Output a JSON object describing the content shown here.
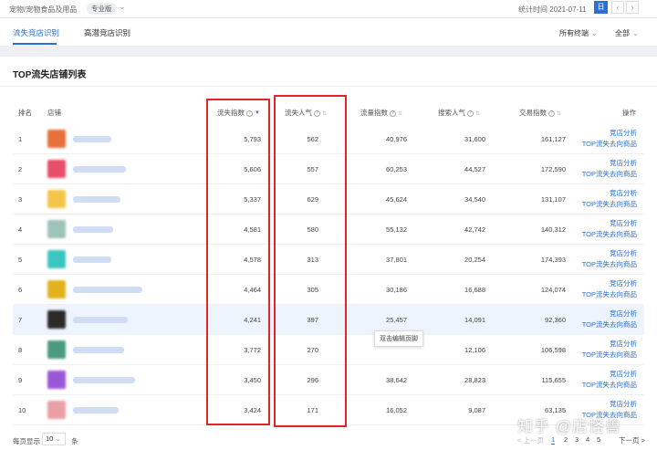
{
  "topbar": {
    "category": "宠物/宠物食品及用品",
    "edition_badge": "专业版",
    "stat_time": "统计时间 2021-07-11",
    "day_button": "日",
    "prev": "‹",
    "next": "›"
  },
  "tabs": [
    {
      "label": "流失竞店识别",
      "active": true
    },
    {
      "label": "高潜竞店识别",
      "active": false
    }
  ],
  "filters": {
    "terminal": "所有终端",
    "scope": "全部"
  },
  "panel": {
    "title": "TOP流失店铺列表"
  },
  "table": {
    "headers": {
      "rank": "排名",
      "shop": "店铺",
      "lost_index": "流失指数",
      "lost_popularity": "流失人气",
      "traffic_index": "流量指数",
      "search_popularity": "搜索人气",
      "trade_index": "交易指数",
      "action": "操作"
    },
    "rows": [
      {
        "rank": "1",
        "lost_index": "5,793",
        "lost_popularity": "562",
        "traffic_index": "40,976",
        "search_popularity": "31,600",
        "trade_index": "161,127"
      },
      {
        "rank": "2",
        "lost_index": "5,606",
        "lost_popularity": "557",
        "traffic_index": "60,253",
        "search_popularity": "44,527",
        "trade_index": "172,590"
      },
      {
        "rank": "3",
        "lost_index": "5,337",
        "lost_popularity": "629",
        "traffic_index": "45,624",
        "search_popularity": "34,540",
        "trade_index": "131,107"
      },
      {
        "rank": "4",
        "lost_index": "4,581",
        "lost_popularity": "580",
        "traffic_index": "55,132",
        "search_popularity": "42,742",
        "trade_index": "140,312"
      },
      {
        "rank": "5",
        "lost_index": "4,578",
        "lost_popularity": "313",
        "traffic_index": "37,801",
        "search_popularity": "20,254",
        "trade_index": "174,393"
      },
      {
        "rank": "6",
        "lost_index": "4,464",
        "lost_popularity": "305",
        "traffic_index": "30,186",
        "search_popularity": "16,688",
        "trade_index": "124,074"
      },
      {
        "rank": "7",
        "lost_index": "4,241",
        "lost_popularity": "397",
        "traffic_index": "25,457",
        "search_popularity": "14,091",
        "trade_index": "92,360"
      },
      {
        "rank": "8",
        "lost_index": "3,772",
        "lost_popularity": "270",
        "traffic_index": "",
        "search_popularity": "12,106",
        "trade_index": "106,598"
      },
      {
        "rank": "9",
        "lost_index": "3,450",
        "lost_popularity": "296",
        "traffic_index": "38,642",
        "search_popularity": "28,823",
        "trade_index": "115,655"
      },
      {
        "rank": "10",
        "lost_index": "3,424",
        "lost_popularity": "171",
        "traffic_index": "16,052",
        "search_popularity": "9,087",
        "trade_index": "63,135"
      }
    ],
    "action_labels": {
      "analysis": "竞店分析",
      "top_goods": "TOP流失去向商品"
    },
    "thumb_colors": [
      "#e8703a",
      "#e84d6a",
      "#f3c64a",
      "#9fc3b8",
      "#3cc6c0",
      "#e2b21e",
      "#2a2a2a",
      "#4a9a82",
      "#9a57d8",
      "#e9a0a4"
    ]
  },
  "tooltip": "双击编辑页脚",
  "footer": {
    "per_page_label": "每页显示",
    "per_page_value": "10",
    "per_page_unit": "条",
    "prev_label": "< 上一页",
    "pages": [
      "1",
      "2",
      "3",
      "4",
      "5"
    ],
    "current_page": "1",
    "next_label": "下一页 >"
  },
  "watermark": "知乎 @店怪兽",
  "colors": {
    "accent": "#2b6fd6",
    "highlight_box": "#e0262b",
    "highlight_row": "#eef4fd"
  }
}
